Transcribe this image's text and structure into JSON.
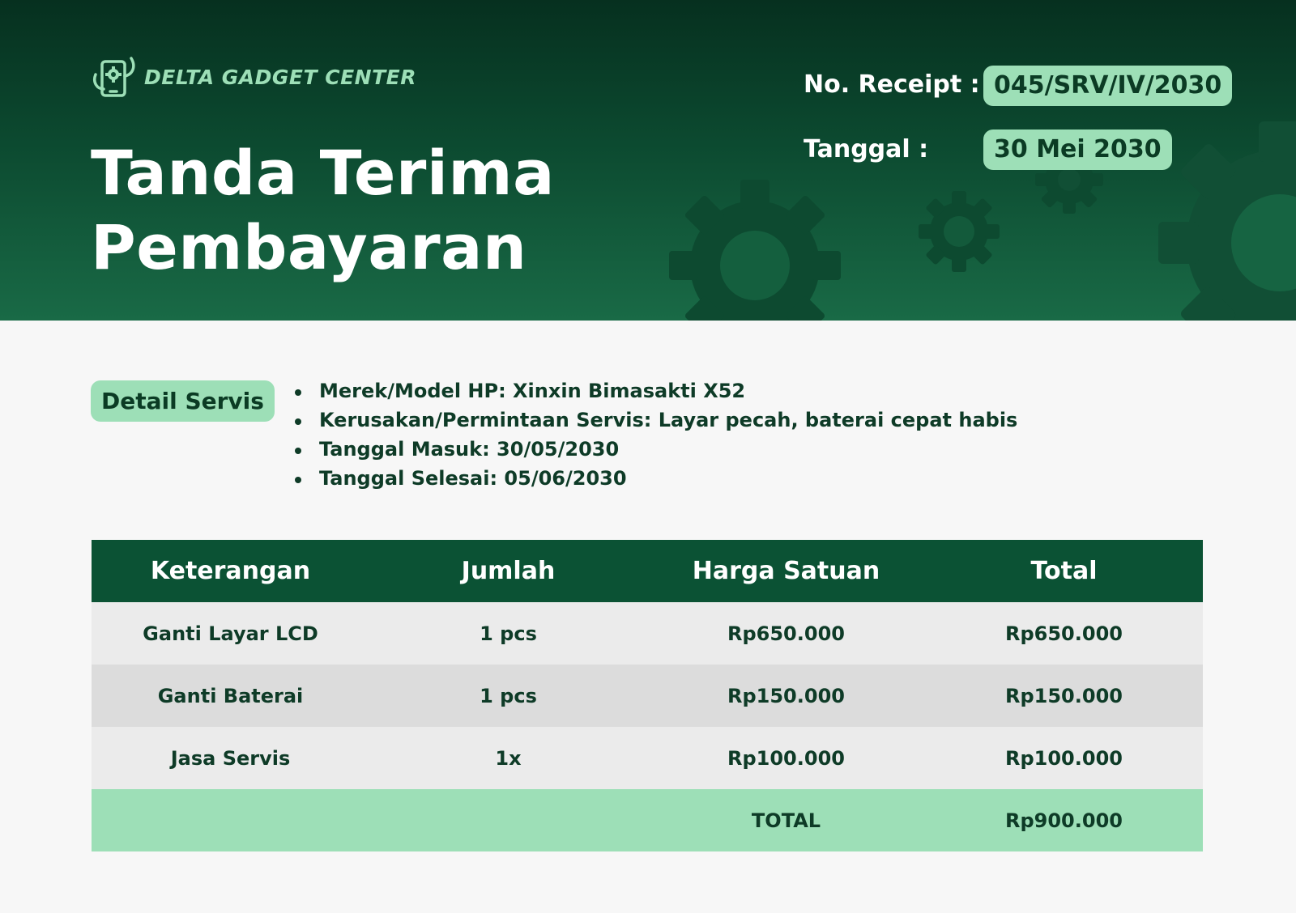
{
  "brand": {
    "name": "DELTA GADGET CENTER",
    "logo_icon": "phone-repair-icon",
    "text_color": "#9ddfb7"
  },
  "title": {
    "line1": "Tanda Terima",
    "line2": "Pembayaran"
  },
  "receipt": {
    "number_label": "No. Receipt :",
    "number_value": "045/SRV/IV/2030",
    "date_label": "Tanggal :",
    "date_value": "30 Mei 2030"
  },
  "detail": {
    "badge": "Detail Servis",
    "items": [
      "Merek/Model HP: Xinxin Bimasakti X52",
      "Kerusakan/Permintaan Servis: Layar pecah, baterai cepat habis",
      "Tanggal Masuk: 30/05/2030",
      "Tanggal Selesai: 05/06/2030"
    ]
  },
  "table": {
    "headers": [
      "Keterangan",
      "Jumlah",
      "Harga Satuan",
      "Total"
    ],
    "rows": [
      [
        "Ganti Layar LCD",
        "1 pcs",
        "Rp650.000",
        "Rp650.000"
      ],
      [
        "Ganti Baterai",
        "1 pcs",
        "Rp150.000",
        "Rp150.000"
      ],
      [
        "Jasa Servis",
        "1x",
        "Rp100.000",
        "Rp100.000"
      ]
    ],
    "total_label": "TOTAL",
    "total_value": "Rp900.000"
  },
  "colors": {
    "header_dark": "#06301f",
    "header_light": "#196a46",
    "accent_mint": "#9ddfb7",
    "table_header": "#0b5234",
    "text_dark": "#0e3b27"
  },
  "decor_icons": [
    "gear-icon",
    "gear-icon",
    "gear-icon",
    "gear-icon"
  ]
}
